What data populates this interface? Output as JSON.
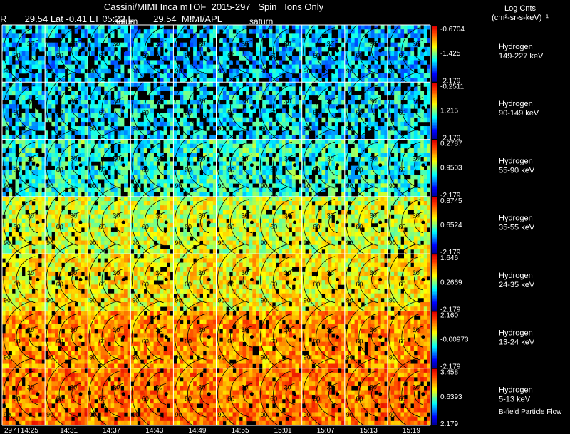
{
  "header": {
    "title_line1": "Cassini/MIMI Inca mTOF  2015-297   Spin   Ions Only",
    "title_line2": "R       29.54 Lat -0.41 LT 05:22 L        29.54  MIMI/APL",
    "colorbar_title_line1": "Log Cnts",
    "colorbar_title_line2": "(cm²-sr-s-keV)⁻¹",
    "overlay_word": "saturn",
    "footer_label": "B-field Particle Flow"
  },
  "colors": {
    "background": "#000000",
    "grid": "#ffffff",
    "text": "#ffffff",
    "contour": "#000000",
    "colormap": [
      "#0000a0",
      "#0000ff",
      "#0080ff",
      "#00ffff",
      "#80ff80",
      "#ffff00",
      "#ffa000",
      "#ff4000",
      "#e00000"
    ]
  },
  "chart_data": {
    "type": "heatmap",
    "x": [
      "297T14:25",
      "14:31",
      "14:37",
      "14:43",
      "14:49",
      "14:55",
      "15:01",
      "15:07",
      "15:13",
      "15:19"
    ],
    "rows": [
      {
        "species": "Hydrogen",
        "energy": "149-227 keV",
        "cmax": "-0.6704",
        "cmid": "-1.425",
        "cmin": "-2.179",
        "level": 0.32
      },
      {
        "species": "Hydrogen",
        "energy": "90-149 keV",
        "cmax": "-0.2511",
        "cmid": "1.215",
        "cmin": "-2.179",
        "level": 0.36
      },
      {
        "species": "Hydrogen",
        "energy": "55-90 keV",
        "cmax": "0.2787",
        "cmid": "0.9503",
        "cmin": "-2.179",
        "level": 0.45
      },
      {
        "species": "Hydrogen",
        "energy": "35-55 keV",
        "cmax": "0.8745",
        "cmid": "0.6524",
        "cmin": "-2.179",
        "level": 0.62
      },
      {
        "species": "Hydrogen",
        "energy": "24-35 keV",
        "cmax": "1.646",
        "cmid": "0.2669",
        "cmin": "-2.179",
        "level": 0.68
      },
      {
        "species": "Hydrogen",
        "energy": "13-24 keV",
        "cmax": "2.160",
        "cmid": "-0.00973",
        "cmin": "-2.179",
        "level": 0.8
      },
      {
        "species": "Hydrogen",
        "energy": "5-13 keV",
        "cmax": "3.458",
        "cmid": "0.6393",
        "cmin": "2.179",
        "level": 0.84
      }
    ],
    "contour_labels": [
      "30",
      "60",
      "90"
    ]
  }
}
